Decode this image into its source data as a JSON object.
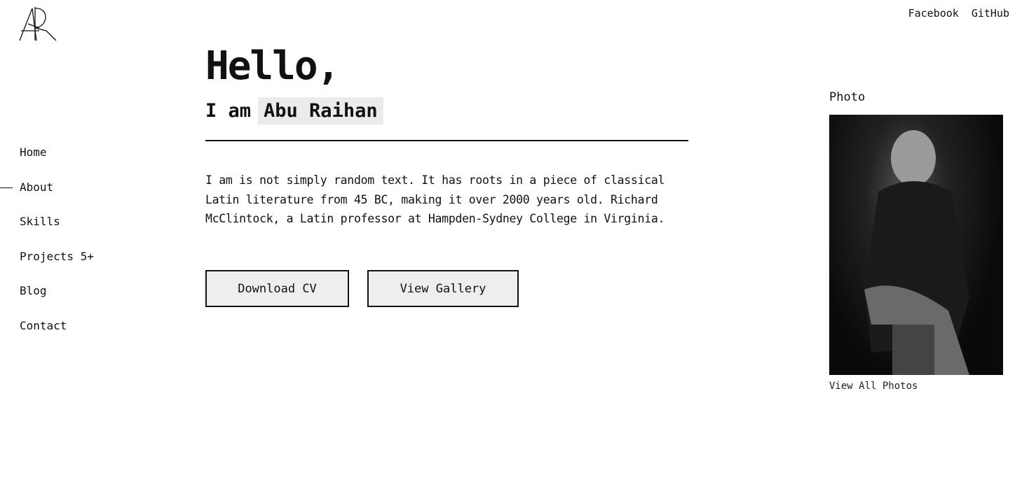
{
  "logo": {
    "text": "AR"
  },
  "social": [
    {
      "label": "Facebook"
    },
    {
      "label": "GitHub"
    }
  ],
  "nav": [
    {
      "label": "Home"
    },
    {
      "label": "About",
      "active": true
    },
    {
      "label": "Skills"
    },
    {
      "label": "Projects 5+"
    },
    {
      "label": "Blog"
    },
    {
      "label": "Contact"
    }
  ],
  "hero": {
    "greeting": "Hello,",
    "intro": "I am",
    "name": "Abu Raihan",
    "bio": "I am is not simply random text. It has roots in a piece of classical Latin literature from 45 BC, making it over 2000 years old. Richard McClintock, a Latin professor at Hampden-Sydney College in Virginia.",
    "download_cv": "Download CV",
    "view_gallery": "View Gallery"
  },
  "photo": {
    "label": "Photo",
    "view_all": "View All Photos"
  }
}
